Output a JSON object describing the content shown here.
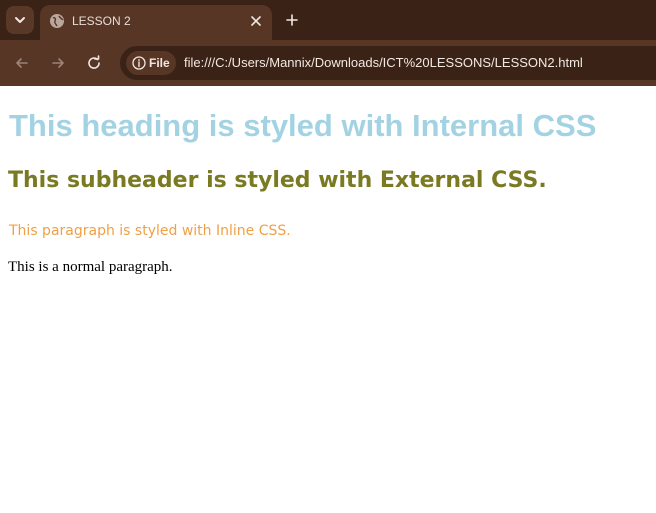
{
  "browser": {
    "tab": {
      "title": "LESSON 2"
    },
    "address_bar": {
      "site_chip": "File",
      "url": "file:///C:/Users/Mannix/Downloads/ICT%20LESSONS/LESSON2.html"
    },
    "icons": {
      "tab_search": "chevron-down-icon",
      "favicon": "globe-icon",
      "close": "close-icon",
      "new_tab": "plus-icon",
      "back": "arrow-left-icon",
      "forward": "arrow-right-icon",
      "reload": "reload-icon",
      "info": "info-icon"
    }
  },
  "page": {
    "heading": "This heading is styled with Internal CSS",
    "subheader": "This subheader is styled with External CSS.",
    "inline_paragraph": "This paragraph is styled with Inline CSS.",
    "normal_paragraph": "This is a normal paragraph."
  },
  "colors": {
    "heading": "#a3d3e3",
    "subheader": "#7a7a22",
    "inline_paragraph": "#f0a046",
    "tabstrip_bg": "#3b2216",
    "toolbar_bg": "#573626"
  }
}
